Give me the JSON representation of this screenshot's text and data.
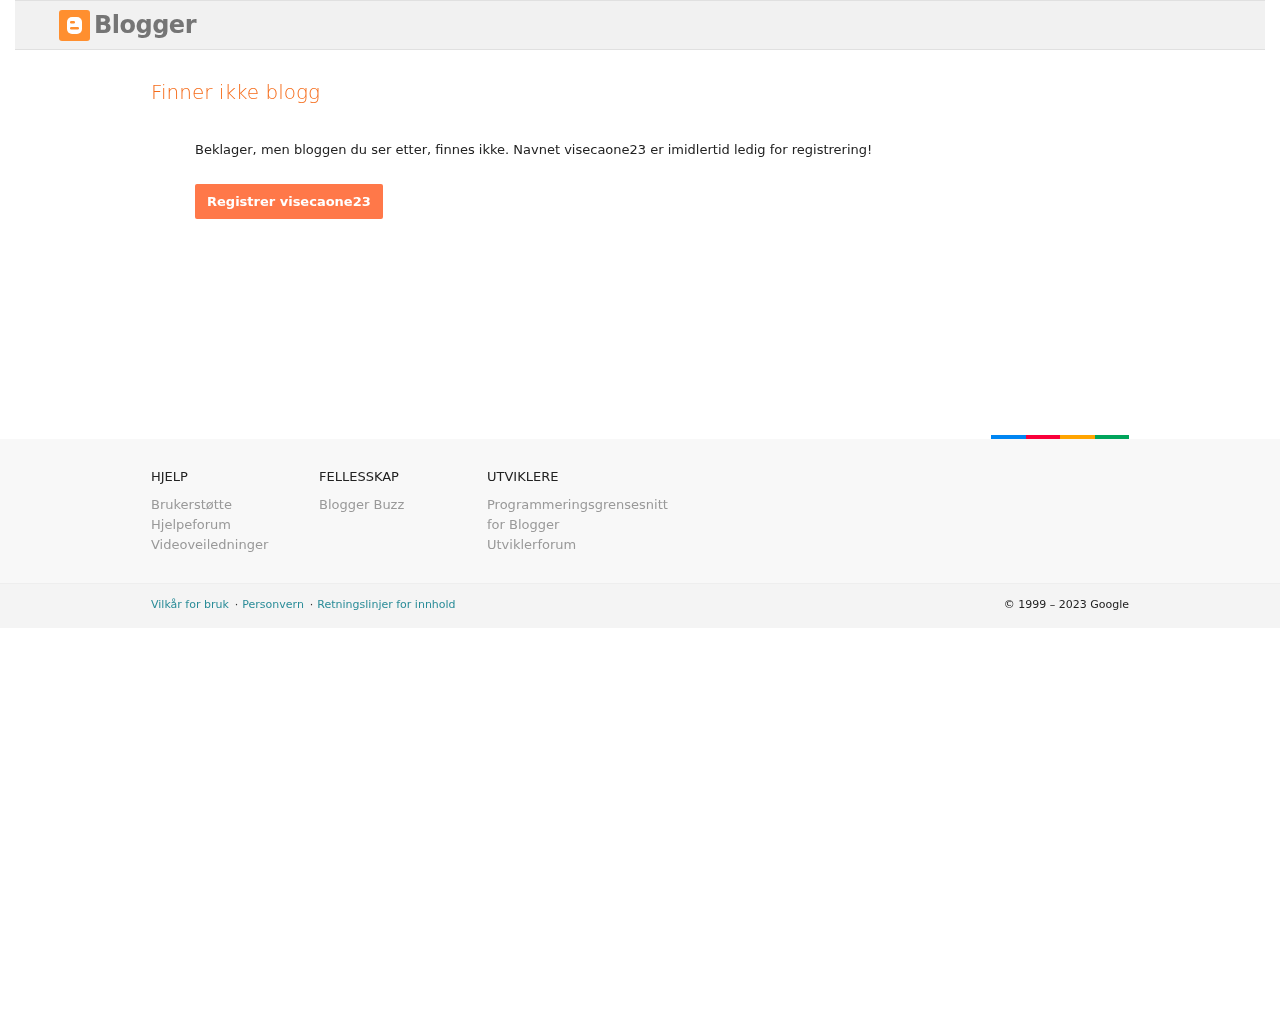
{
  "header": {
    "logo_text": "Blogger"
  },
  "main": {
    "title": "Finner ikke blogg",
    "message": "Beklager, men bloggen du ser etter, finnes ikke. Navnet visecaone23 er imidlertid ledig for registrering!",
    "button": "Registrer visecaone23"
  },
  "footer_columns": [
    {
      "heading": "HJELP",
      "links": [
        "Brukerstøtte",
        "Hjelpeforum",
        "Videoveiledninger"
      ]
    },
    {
      "heading": "FELLESSKAP",
      "links": [
        "Blogger Buzz"
      ]
    },
    {
      "heading": "UTVIKLERE",
      "links": [
        "Programmeringsgrensesnitt for Blogger",
        "Utviklerforum"
      ]
    }
  ],
  "bottom_bar": {
    "links": [
      "Vilkår for bruk",
      "Personvern",
      "Retningslinjer for innhold"
    ],
    "separator": "·",
    "copyright": "© 1999 – 2023 Google"
  }
}
